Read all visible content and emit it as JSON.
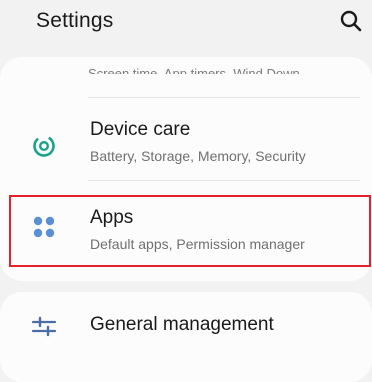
{
  "header": {
    "title": "Settings",
    "search_icon": "search-icon"
  },
  "list": {
    "truncated_subtitle": "Screen time, App timers, Wind Down",
    "device_care": {
      "title": "Device care",
      "subtitle": "Battery, Storage, Memory, Security",
      "icon": "device-care-icon",
      "icon_color": "#1aa28a"
    },
    "apps": {
      "title": "Apps",
      "subtitle": "Default apps, Permission manager",
      "icon": "apps-grid-icon",
      "icon_color": "#5b8fd6"
    },
    "general_management": {
      "title": "General management",
      "icon": "sliders-icon",
      "icon_color": "#4a6fa8"
    }
  },
  "colors": {
    "highlight": "#e8202a",
    "background": "#f2f2f2",
    "card": "#fcfcfc"
  }
}
